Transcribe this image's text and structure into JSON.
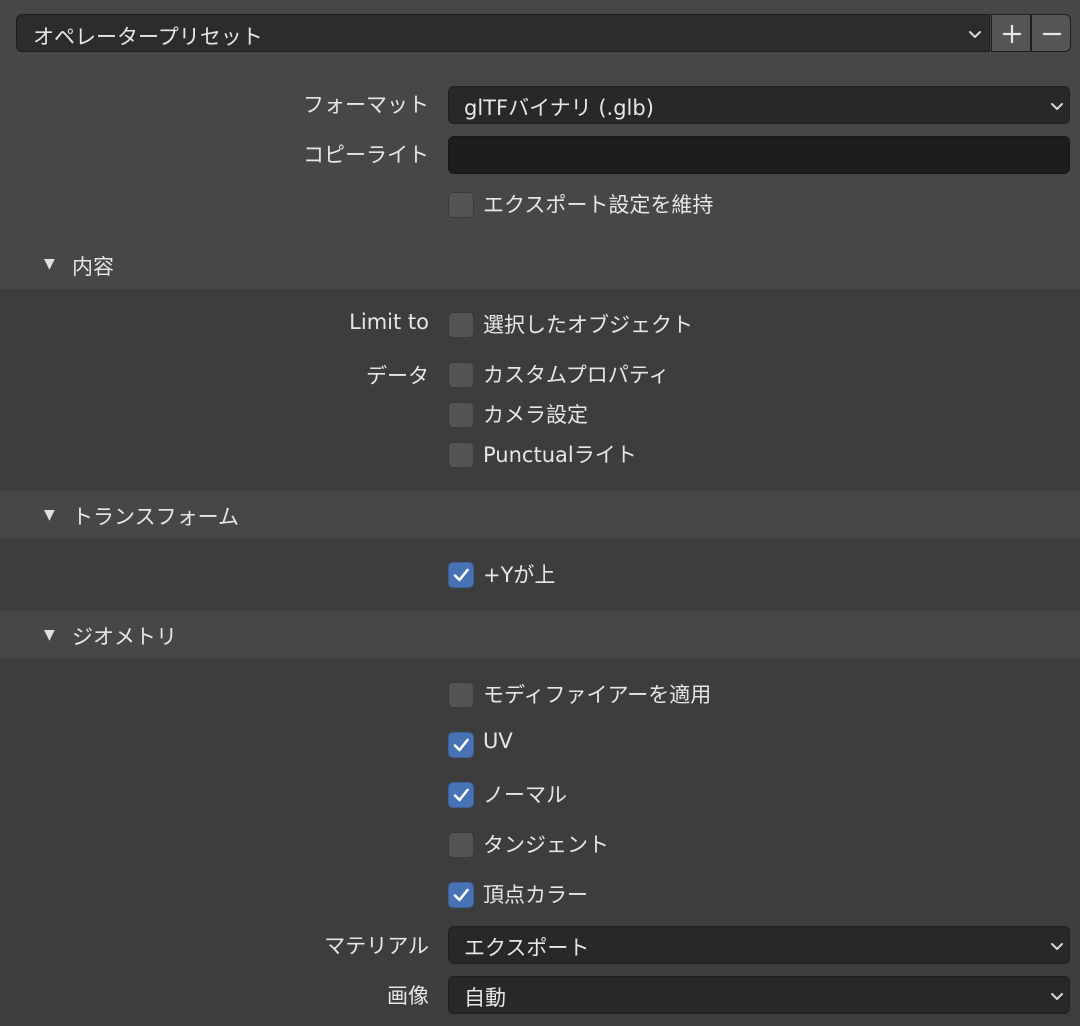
{
  "preset": {
    "label": "オペレータープリセット",
    "add_icon": "plus-icon",
    "remove_icon": "minus-icon"
  },
  "general": {
    "format_label": "フォーマット",
    "format_value": "glTFバイナリ (.glb)",
    "copyright_label": "コピーライト",
    "copyright_value": "",
    "keep_settings_label": "エクスポート設定を維持",
    "keep_settings_checked": false
  },
  "content": {
    "title": "内容",
    "limit_to_label": "Limit to",
    "selected_objects_label": "選択したオブジェクト",
    "selected_objects_checked": false,
    "data_label": "データ",
    "custom_properties_label": "カスタムプロパティ",
    "custom_properties_checked": false,
    "camera_settings_label": "カメラ設定",
    "camera_settings_checked": false,
    "punctual_lights_label": "Punctualライト",
    "punctual_lights_checked": false
  },
  "transform": {
    "title": "トランスフォーム",
    "y_up_label": "+Yが上",
    "y_up_checked": true
  },
  "geometry": {
    "title": "ジオメトリ",
    "apply_modifiers_label": "モディファイアーを適用",
    "apply_modifiers_checked": false,
    "uv_label": "UV",
    "uv_checked": true,
    "normals_label": "ノーマル",
    "normals_checked": true,
    "tangents_label": "タンジェント",
    "tangents_checked": false,
    "vertex_colors_label": "頂点カラー",
    "vertex_colors_checked": true,
    "material_label": "マテリアル",
    "material_value": "エクスポート",
    "image_label": "画像",
    "image_value": "自動"
  },
  "colors": {
    "panel_header": "#474747",
    "panel_body": "#3d3d3d",
    "checkbox_on": "#4772b3",
    "checkbox_off": "#545454"
  }
}
